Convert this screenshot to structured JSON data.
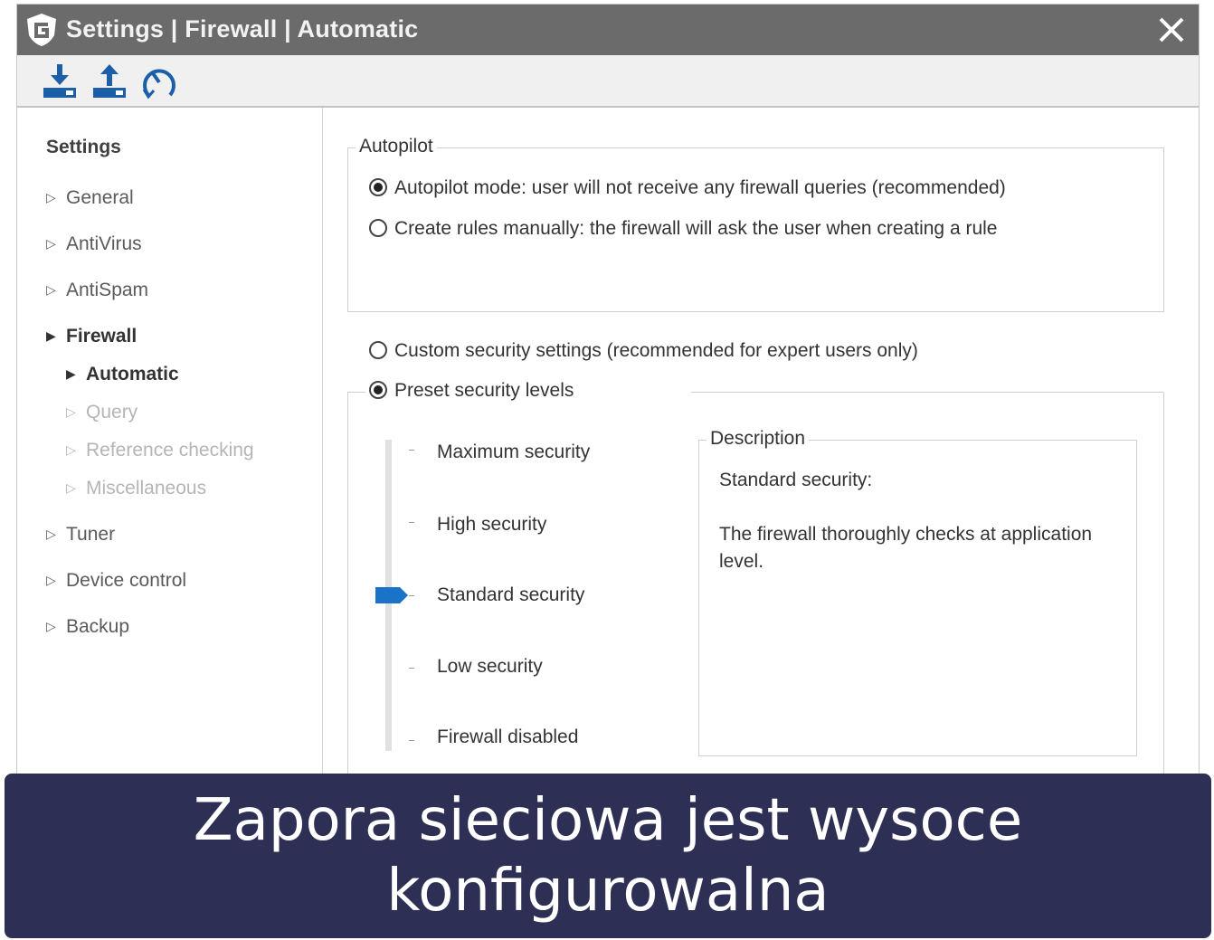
{
  "window": {
    "title": "Settings | Firewall | Automatic"
  },
  "toolbar": {
    "icons": [
      "import-icon",
      "export-icon",
      "restore-defaults-icon"
    ]
  },
  "sidebar": {
    "heading": "Settings",
    "items": [
      {
        "label": "General",
        "state": "normal"
      },
      {
        "label": "AntiVirus",
        "state": "normal"
      },
      {
        "label": "AntiSpam",
        "state": "normal"
      },
      {
        "label": "Firewall",
        "state": "active"
      },
      {
        "label": "Automatic",
        "state": "active"
      },
      {
        "label": "Query",
        "state": "disabled"
      },
      {
        "label": "Reference checking",
        "state": "disabled"
      },
      {
        "label": "Miscellaneous",
        "state": "disabled"
      },
      {
        "label": "Tuner",
        "state": "normal"
      },
      {
        "label": "Device control",
        "state": "normal"
      },
      {
        "label": "Backup",
        "state": "normal"
      }
    ]
  },
  "autopilot": {
    "legend": "Autopilot",
    "options": [
      {
        "label": "Autopilot mode: user will not receive any firewall queries (recommended)",
        "checked": true
      },
      {
        "label": "Create rules manually: the firewall will ask the user when creating a rule",
        "checked": false
      }
    ]
  },
  "security": {
    "custom_label": "Custom security settings (recommended for expert users only)",
    "custom_checked": false,
    "preset_label": "Preset security levels",
    "preset_checked": true,
    "levels": [
      "Maximum security",
      "High security",
      "Standard security",
      "Low security",
      "Firewall disabled"
    ],
    "selected_level_index": 2,
    "description": {
      "legend": "Description",
      "title": "Standard security:",
      "body": "The firewall thoroughly checks at application level."
    }
  },
  "banner": {
    "text": "Zapora sieciowa jest wysoce konfigurowalna"
  },
  "colors": {
    "titlebar": "#6b6b6b",
    "accent": "#1a73c8",
    "banner": "#2d2f55"
  }
}
